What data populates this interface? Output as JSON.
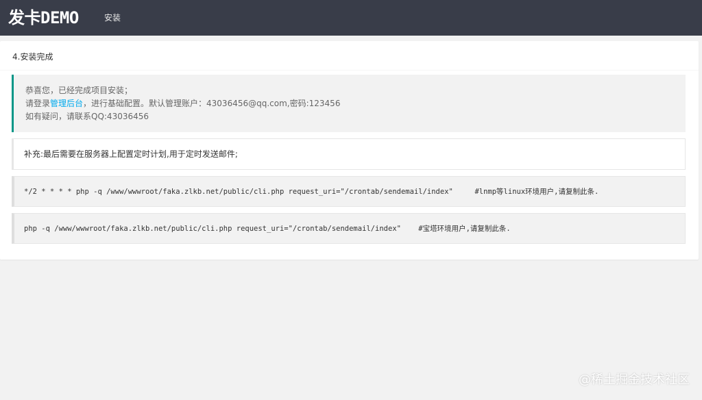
{
  "header": {
    "logo": "发卡DEMO",
    "nav": [
      {
        "label": "安装"
      }
    ]
  },
  "card": {
    "title": "4.安装完成",
    "notice": {
      "line1": "恭喜您，已经完成项目安装；",
      "line2_prefix": "请登录",
      "line2_link": "管理后台",
      "line2_suffix": "，进行基础配置。默认管理账户：43036456@qq.com,密码:123456",
      "line3": "如有疑问，请联系QQ:43036456"
    },
    "supplement": "补充:最后需要在服务器上配置定时计划,用于定时发送邮件;",
    "commands": [
      {
        "text": "*/2 * * * * php -q /www/wwwroot/faka.zlkb.net/public/cli.php request_uri=\"/crontab/sendemail/index\"     #lnmp等linux环境用户,请复制此条."
      },
      {
        "text": "php -q /www/wwwroot/faka.zlkb.net/public/cli.php request_uri=\"/crontab/sendemail/index\"    #宝塔环境用户,请复制此条."
      }
    ]
  },
  "watermark": "@稀土掘金技术社区",
  "colors": {
    "topbar": "#393d49",
    "accent_border": "#009688",
    "link": "#01aaed",
    "page_bg": "#f2f2f2"
  }
}
